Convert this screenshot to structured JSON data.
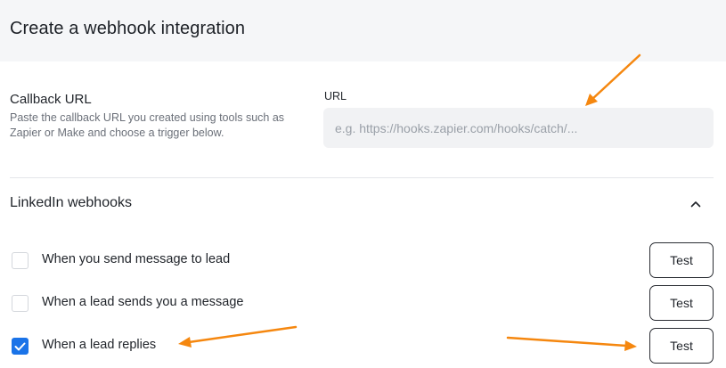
{
  "header": {
    "title": "Create a webhook integration"
  },
  "callback": {
    "title": "Callback URL",
    "description": "Paste the callback URL you created using tools such as Zapier or Make and choose a trigger below.",
    "url_label": "URL",
    "url_value": "",
    "url_placeholder": "e.g. https://hooks.zapier.com/hooks/catch/..."
  },
  "linkedin": {
    "title": "LinkedIn webhooks",
    "toggle_icon": "chevron-up-icon",
    "items": [
      {
        "label": "When you send message to lead",
        "checked": false,
        "test_label": "Test"
      },
      {
        "label": "When a lead sends you a message",
        "checked": false,
        "test_label": "Test"
      },
      {
        "label": "When a lead replies",
        "checked": true,
        "test_label": "Test"
      }
    ]
  },
  "colors": {
    "accent": "#1a73e8",
    "annotation_arrow": "#f5870f",
    "header_bg": "#f5f6f8",
    "input_bg": "#f1f2f4"
  }
}
